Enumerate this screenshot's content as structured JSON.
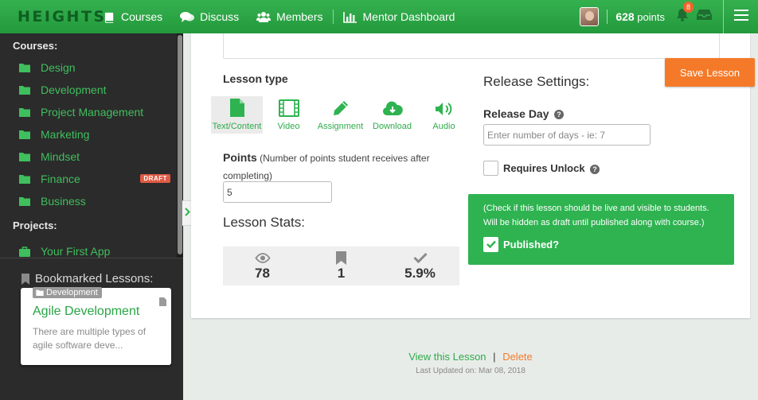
{
  "brand": "HEIGHTS",
  "nav": {
    "courses": "Courses",
    "discuss": "Discuss",
    "members": "Members",
    "mentor_dashboard": "Mentor Dashboard"
  },
  "user": {
    "points_value": "628",
    "points_label": "points",
    "notifications": "8"
  },
  "sidebar": {
    "courses_heading": "Courses:",
    "courses": [
      {
        "label": "Design"
      },
      {
        "label": "Development"
      },
      {
        "label": "Project Management"
      },
      {
        "label": "Marketing"
      },
      {
        "label": "Mindset"
      },
      {
        "label": "Finance",
        "badge": "DRAFT"
      },
      {
        "label": "Business"
      }
    ],
    "projects_heading": "Projects:",
    "projects": [
      {
        "label": "Your First App"
      }
    ],
    "bookmarks_heading": "Bookmarked Lessons:",
    "bookmark": {
      "tag": "Development",
      "title": "Agile Development",
      "description": "There are multiple types of agile software deve..."
    }
  },
  "lesson": {
    "type_heading": "Lesson type",
    "types": [
      {
        "label": "Text/Content",
        "icon": "file-icon",
        "active": true
      },
      {
        "label": "Video",
        "icon": "film-icon"
      },
      {
        "label": "Assignment",
        "icon": "pencil-icon"
      },
      {
        "label": "Download",
        "icon": "cloud-download-icon"
      },
      {
        "label": "Audio",
        "icon": "volume-icon"
      }
    ],
    "points_label": "Points",
    "points_hint": "(Number of points student receives after completing)",
    "points_value": "5",
    "stats_heading": "Lesson Stats:",
    "stats": [
      {
        "icon": "eye-icon",
        "value": "78"
      },
      {
        "icon": "bookmark-icon",
        "value": "1"
      },
      {
        "icon": "check-icon",
        "value": "5.9%"
      }
    ]
  },
  "release": {
    "heading": "Release Settings:",
    "day_label": "Release Day",
    "day_placeholder": "Enter number of days - ie: 7",
    "unlock_label": "Requires Unlock",
    "publish_note": "(Check if this lesson should be live and visible to students. Will be hidden as draft until published along with course.)",
    "published_label": "Published?"
  },
  "actions": {
    "save": "Save Lesson",
    "view": "View this Lesson",
    "separator": "|",
    "delete": "Delete"
  },
  "updated": "Last Updated on: Mar 08, 2018",
  "colors": {
    "brand_green": "#2eb350",
    "accent_orange": "#f47a2a",
    "sidebar_bg": "#2b2b2b"
  }
}
